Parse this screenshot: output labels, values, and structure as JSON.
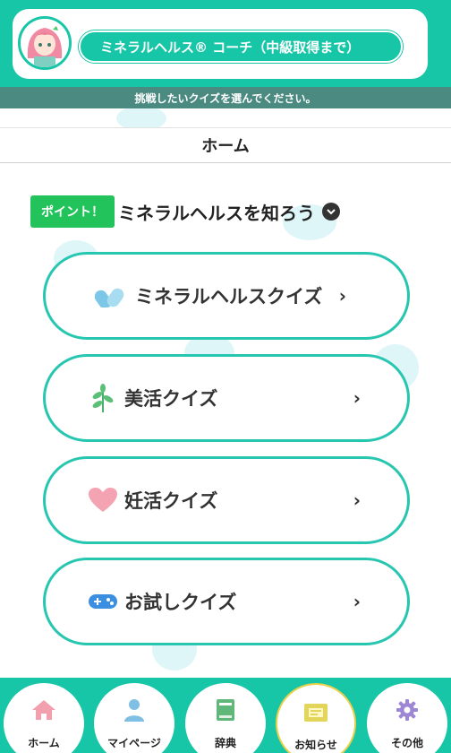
{
  "header": {
    "title": "ミネラルヘルス® コーチ（中級取得まで）",
    "subtitle": "挑戦したいクイズを選んでください。"
  },
  "page": {
    "title": "ホーム"
  },
  "section": {
    "badge": "ポイント！",
    "title": "ミネラルヘルスを知ろう"
  },
  "quizzes": [
    {
      "label": "ミネラルヘルスクイズ",
      "icon": "pills-icon",
      "arrow": "›"
    },
    {
      "label": "美活クイズ",
      "icon": "leaf-icon",
      "arrow": "›"
    },
    {
      "label": "妊活クイズ",
      "icon": "heart-icon",
      "arrow": "›"
    },
    {
      "label": "お試しクイズ",
      "icon": "gamepad-icon",
      "arrow": "›"
    }
  ],
  "nav": [
    {
      "label": "ホーム",
      "icon": "home-icon"
    },
    {
      "label": "マイページ",
      "icon": "user-icon"
    },
    {
      "label": "辞典",
      "icon": "book-icon"
    },
    {
      "label": "お知らせ",
      "icon": "notice-icon"
    },
    {
      "label": "その他",
      "icon": "gear-icon"
    }
  ],
  "colors": {
    "accent": "#17c5a7",
    "point_badge": "#22c35a",
    "button_border": "#27c6b0"
  }
}
